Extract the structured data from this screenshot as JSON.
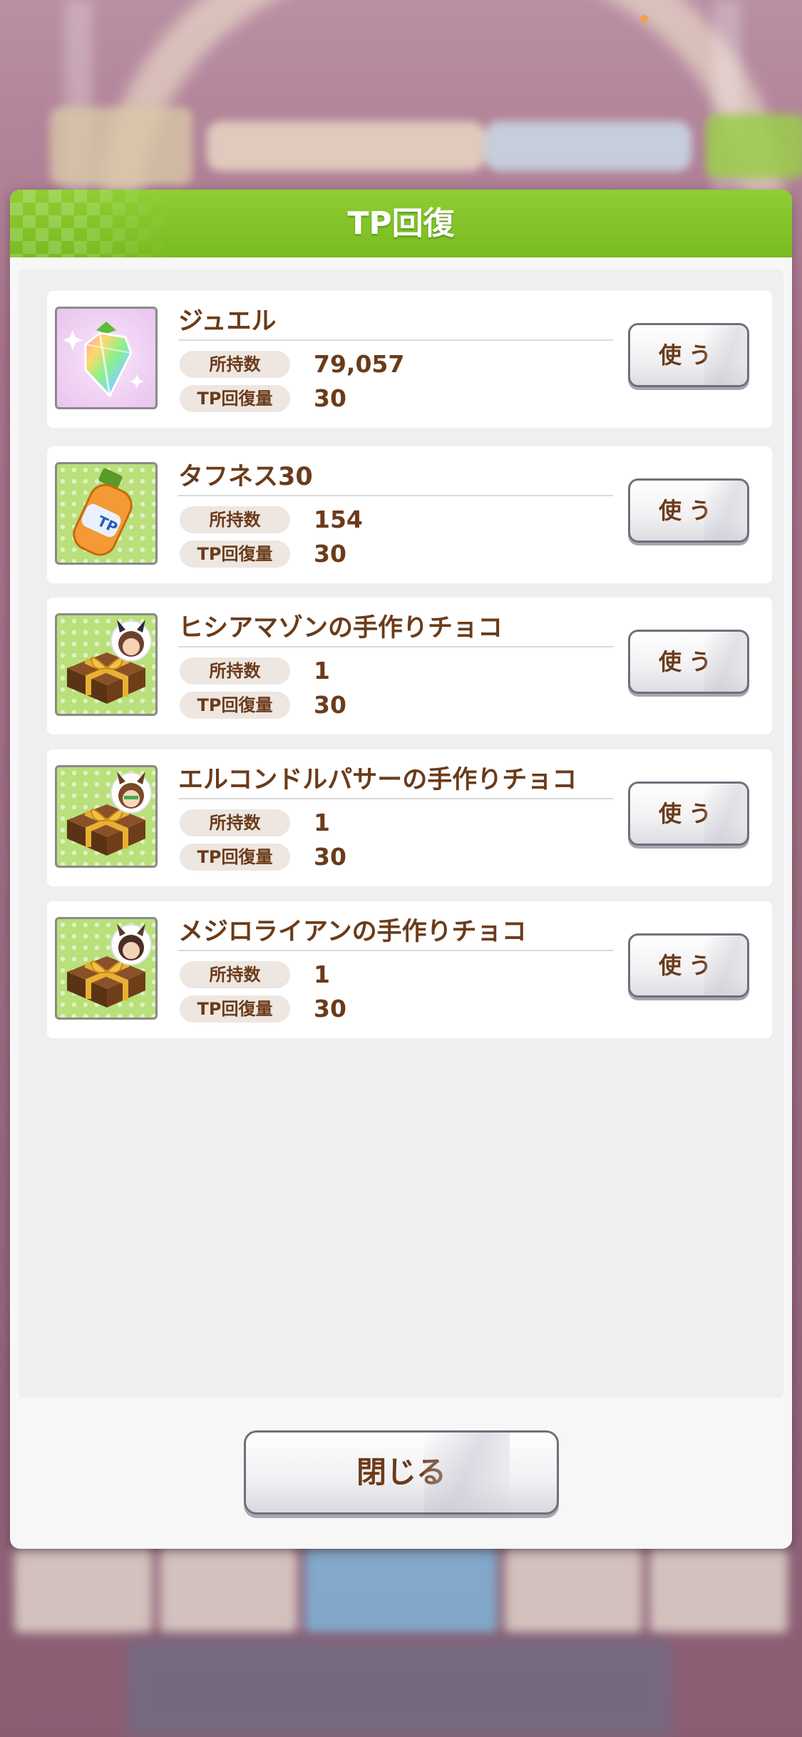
{
  "dialog": {
    "title": "TP回復",
    "close_label": "閉じる"
  },
  "labels": {
    "owned": "所持数",
    "recovery": "TP回復量",
    "use": "使う"
  },
  "items": [
    {
      "name": "ジュエル",
      "owned": "79,057",
      "recovery": "30",
      "icon": "jewel-icon"
    },
    {
      "name": "タフネス30",
      "owned": "154",
      "recovery": "30",
      "icon": "toughness-bottle-icon",
      "bottle_text": "TP"
    },
    {
      "name": "ヒシアマゾンの手作りチョコ",
      "owned": "1",
      "recovery": "30",
      "icon": "chocolate-gift-icon"
    },
    {
      "name": "エルコンドルパサーの手作りチョコ",
      "owned": "1",
      "recovery": "30",
      "icon": "chocolate-gift-icon"
    },
    {
      "name": "メジロライアンの手作りチョコ",
      "owned": "1",
      "recovery": "30",
      "icon": "chocolate-gift-icon"
    }
  ],
  "colors": {
    "header_green": "#7cc026",
    "text_brown": "#6b3b1a",
    "pill_bg": "#ede6e1",
    "notification_dot": "#f1a04c"
  }
}
